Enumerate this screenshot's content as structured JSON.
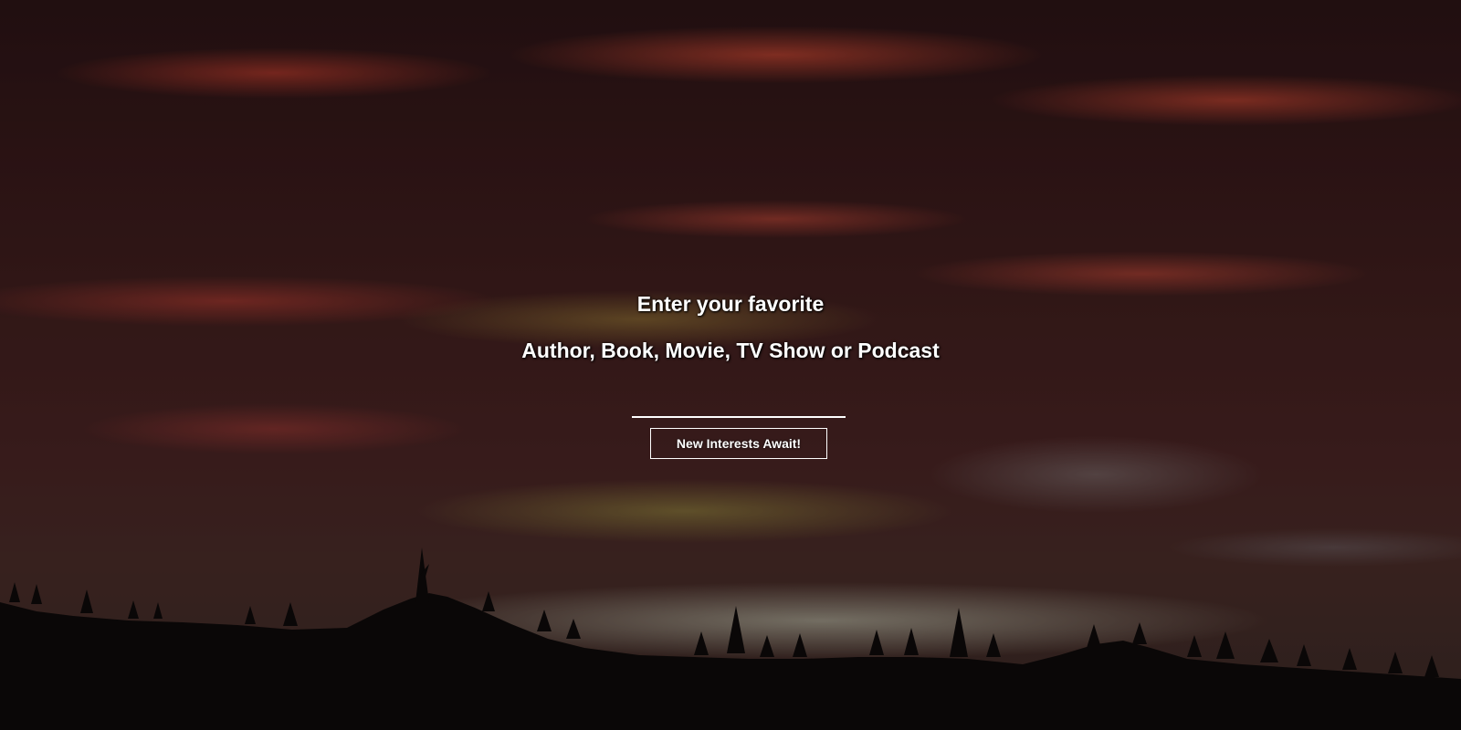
{
  "hero": {
    "heading_line1": "Enter your favorite",
    "heading_line2": "Author, Book, Movie, TV Show or Podcast",
    "search_value": "",
    "cta_label": "New Interests Await!"
  },
  "background": {
    "description_colors": {
      "sky_dark": "#2c1416",
      "cloud_red": "#c8463a",
      "glow_yellow": "#aaa046",
      "horizon_light": "#c0c0b0",
      "silhouette": "#0e0a0a"
    }
  }
}
